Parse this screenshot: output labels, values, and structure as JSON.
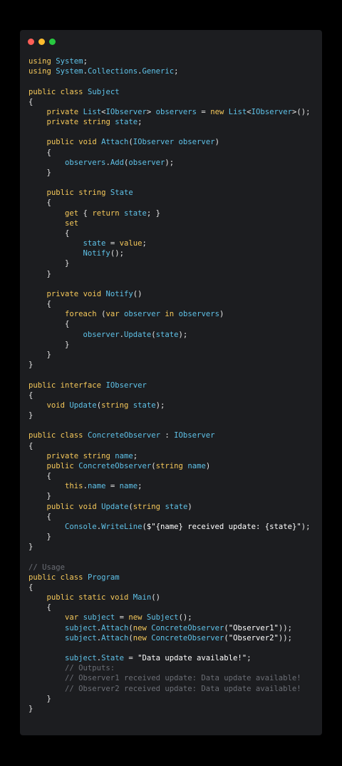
{
  "window": {
    "controls": [
      {
        "name": "close-button",
        "color": "#ff5f57"
      },
      {
        "name": "minimize-button",
        "color": "#febc2e"
      },
      {
        "name": "maximize-button",
        "color": "#28c840"
      }
    ]
  },
  "colors": {
    "background": "#000000",
    "editor": "#1c1d20",
    "keyword": "#f5c85a",
    "type": "#5fc2e8",
    "comment": "#6b6e75",
    "plain": "#e6e6e6"
  },
  "code": {
    "language": "C#",
    "lines": [
      [
        [
          "k",
          "using"
        ],
        [
          "p",
          " "
        ],
        [
          "t",
          "System"
        ],
        [
          "p",
          ";"
        ]
      ],
      [
        [
          "k",
          "using"
        ],
        [
          "p",
          " "
        ],
        [
          "t",
          "System"
        ],
        [
          "p",
          "."
        ],
        [
          "t",
          "Collections"
        ],
        [
          "p",
          "."
        ],
        [
          "t",
          "Generic"
        ],
        [
          "p",
          ";"
        ]
      ],
      [],
      [
        [
          "k",
          "public class"
        ],
        [
          "p",
          " "
        ],
        [
          "t",
          "Subject"
        ]
      ],
      [
        [
          "p",
          "{"
        ]
      ],
      [
        [
          "p",
          "    "
        ],
        [
          "k",
          "private"
        ],
        [
          "p",
          " "
        ],
        [
          "t",
          "List"
        ],
        [
          "p",
          "<"
        ],
        [
          "t",
          "IObserver"
        ],
        [
          "p",
          "> "
        ],
        [
          "t",
          "observers"
        ],
        [
          "p",
          " = "
        ],
        [
          "k",
          "new"
        ],
        [
          "p",
          " "
        ],
        [
          "t",
          "List"
        ],
        [
          "p",
          "<"
        ],
        [
          "t",
          "IObserver"
        ],
        [
          "p",
          ">();"
        ]
      ],
      [
        [
          "p",
          "    "
        ],
        [
          "k",
          "private"
        ],
        [
          "p",
          " "
        ],
        [
          "k",
          "string"
        ],
        [
          "p",
          " "
        ],
        [
          "t",
          "state"
        ],
        [
          "p",
          ";"
        ]
      ],
      [],
      [
        [
          "p",
          "    "
        ],
        [
          "k",
          "public"
        ],
        [
          "p",
          " "
        ],
        [
          "k",
          "void"
        ],
        [
          "p",
          " "
        ],
        [
          "t",
          "Attach"
        ],
        [
          "p",
          "("
        ],
        [
          "t",
          "IObserver observer"
        ],
        [
          "p",
          ")"
        ]
      ],
      [
        [
          "p",
          "    {"
        ]
      ],
      [
        [
          "p",
          "        "
        ],
        [
          "t",
          "observers"
        ],
        [
          "p",
          "."
        ],
        [
          "t",
          "Add"
        ],
        [
          "p",
          "("
        ],
        [
          "t",
          "observer"
        ],
        [
          "p",
          ");"
        ]
      ],
      [
        [
          "p",
          "    }"
        ]
      ],
      [],
      [
        [
          "p",
          "    "
        ],
        [
          "k",
          "public"
        ],
        [
          "p",
          " "
        ],
        [
          "k",
          "string"
        ],
        [
          "p",
          " "
        ],
        [
          "t",
          "State"
        ]
      ],
      [
        [
          "p",
          "    {"
        ]
      ],
      [
        [
          "p",
          "        "
        ],
        [
          "k",
          "get"
        ],
        [
          "p",
          " { "
        ],
        [
          "k",
          "return"
        ],
        [
          "p",
          " "
        ],
        [
          "t",
          "state"
        ],
        [
          "p",
          "; }"
        ]
      ],
      [
        [
          "p",
          "        "
        ],
        [
          "k",
          "set"
        ]
      ],
      [
        [
          "p",
          "        {"
        ]
      ],
      [
        [
          "p",
          "            "
        ],
        [
          "t",
          "state"
        ],
        [
          "p",
          " = "
        ],
        [
          "k",
          "value"
        ],
        [
          "p",
          ";"
        ]
      ],
      [
        [
          "p",
          "            "
        ],
        [
          "t",
          "Notify"
        ],
        [
          "p",
          "();"
        ]
      ],
      [
        [
          "p",
          "        }"
        ]
      ],
      [
        [
          "p",
          "    }"
        ]
      ],
      [],
      [
        [
          "p",
          "    "
        ],
        [
          "k",
          "private"
        ],
        [
          "p",
          " "
        ],
        [
          "k",
          "void"
        ],
        [
          "p",
          " "
        ],
        [
          "t",
          "Notify"
        ],
        [
          "p",
          "()"
        ]
      ],
      [
        [
          "p",
          "    {"
        ]
      ],
      [
        [
          "p",
          "        "
        ],
        [
          "k",
          "foreach"
        ],
        [
          "p",
          " ("
        ],
        [
          "k",
          "var"
        ],
        [
          "p",
          " "
        ],
        [
          "t",
          "observer"
        ],
        [
          "p",
          " "
        ],
        [
          "k",
          "in"
        ],
        [
          "p",
          " "
        ],
        [
          "t",
          "observers"
        ],
        [
          "p",
          ")"
        ]
      ],
      [
        [
          "p",
          "        {"
        ]
      ],
      [
        [
          "p",
          "            "
        ],
        [
          "t",
          "observer"
        ],
        [
          "p",
          "."
        ],
        [
          "t",
          "Update"
        ],
        [
          "p",
          "("
        ],
        [
          "t",
          "state"
        ],
        [
          "p",
          ");"
        ]
      ],
      [
        [
          "p",
          "        }"
        ]
      ],
      [
        [
          "p",
          "    }"
        ]
      ],
      [
        [
          "p",
          "}"
        ]
      ],
      [],
      [
        [
          "k",
          "public interface"
        ],
        [
          "p",
          " "
        ],
        [
          "t",
          "IObserver"
        ]
      ],
      [
        [
          "p",
          "{"
        ]
      ],
      [
        [
          "p",
          "    "
        ],
        [
          "k",
          "void"
        ],
        [
          "p",
          " "
        ],
        [
          "t",
          "Update"
        ],
        [
          "p",
          "("
        ],
        [
          "k",
          "string"
        ],
        [
          "p",
          " "
        ],
        [
          "t",
          "state"
        ],
        [
          "p",
          ");"
        ]
      ],
      [
        [
          "p",
          "}"
        ]
      ],
      [],
      [
        [
          "k",
          "public class"
        ],
        [
          "p",
          " "
        ],
        [
          "t",
          "ConcreteObserver"
        ],
        [
          "p",
          " : "
        ],
        [
          "t",
          "IObserver"
        ]
      ],
      [
        [
          "p",
          "{"
        ]
      ],
      [
        [
          "p",
          "    "
        ],
        [
          "k",
          "private"
        ],
        [
          "p",
          " "
        ],
        [
          "k",
          "string"
        ],
        [
          "p",
          " "
        ],
        [
          "t",
          "name"
        ],
        [
          "p",
          ";"
        ]
      ],
      [
        [
          "p",
          "    "
        ],
        [
          "k",
          "public"
        ],
        [
          "p",
          " "
        ],
        [
          "t",
          "ConcreteObserver"
        ],
        [
          "p",
          "("
        ],
        [
          "k",
          "string"
        ],
        [
          "p",
          " "
        ],
        [
          "t",
          "name"
        ],
        [
          "p",
          ")"
        ]
      ],
      [
        [
          "p",
          "    {"
        ]
      ],
      [
        [
          "p",
          "        "
        ],
        [
          "k",
          "this"
        ],
        [
          "p",
          "."
        ],
        [
          "t",
          "name"
        ],
        [
          "p",
          " = "
        ],
        [
          "t",
          "name"
        ],
        [
          "p",
          ";"
        ]
      ],
      [
        [
          "p",
          "    }"
        ]
      ],
      [
        [
          "p",
          "    "
        ],
        [
          "k",
          "public"
        ],
        [
          "p",
          " "
        ],
        [
          "k",
          "void"
        ],
        [
          "p",
          " "
        ],
        [
          "t",
          "Update"
        ],
        [
          "p",
          "("
        ],
        [
          "k",
          "string"
        ],
        [
          "p",
          " "
        ],
        [
          "t",
          "state"
        ],
        [
          "p",
          ")"
        ]
      ],
      [
        [
          "p",
          "    {"
        ]
      ],
      [
        [
          "p",
          "        "
        ],
        [
          "t",
          "Console"
        ],
        [
          "p",
          "."
        ],
        [
          "t",
          "WriteLine"
        ],
        [
          "p",
          "("
        ],
        [
          "s",
          "$\"{name} received update: {state}\""
        ],
        [
          "p",
          ");"
        ]
      ],
      [
        [
          "p",
          "    }"
        ]
      ],
      [
        [
          "p",
          "}"
        ]
      ],
      [],
      [
        [
          "c",
          "// Usage"
        ]
      ],
      [
        [
          "k",
          "public class"
        ],
        [
          "p",
          " "
        ],
        [
          "t",
          "Program"
        ]
      ],
      [
        [
          "p",
          "{"
        ]
      ],
      [
        [
          "p",
          "    "
        ],
        [
          "k",
          "public static void"
        ],
        [
          "p",
          " "
        ],
        [
          "t",
          "Main"
        ],
        [
          "p",
          "()"
        ]
      ],
      [
        [
          "p",
          "    {"
        ]
      ],
      [
        [
          "p",
          "        "
        ],
        [
          "k",
          "var"
        ],
        [
          "p",
          " "
        ],
        [
          "t",
          "subject"
        ],
        [
          "p",
          " = "
        ],
        [
          "k",
          "new"
        ],
        [
          "p",
          " "
        ],
        [
          "t",
          "Subject"
        ],
        [
          "p",
          "();"
        ]
      ],
      [
        [
          "p",
          "        "
        ],
        [
          "t",
          "subject"
        ],
        [
          "p",
          "."
        ],
        [
          "t",
          "Attach"
        ],
        [
          "p",
          "("
        ],
        [
          "k",
          "new"
        ],
        [
          "p",
          " "
        ],
        [
          "t",
          "ConcreteObserver"
        ],
        [
          "p",
          "("
        ],
        [
          "s",
          "\"Observer1\""
        ],
        [
          "p",
          "));"
        ]
      ],
      [
        [
          "p",
          "        "
        ],
        [
          "t",
          "subject"
        ],
        [
          "p",
          "."
        ],
        [
          "t",
          "Attach"
        ],
        [
          "p",
          "("
        ],
        [
          "k",
          "new"
        ],
        [
          "p",
          " "
        ],
        [
          "t",
          "ConcreteObserver"
        ],
        [
          "p",
          "("
        ],
        [
          "s",
          "\"Observer2\""
        ],
        [
          "p",
          "));"
        ]
      ],
      [],
      [
        [
          "p",
          "        "
        ],
        [
          "t",
          "subject"
        ],
        [
          "p",
          "."
        ],
        [
          "t",
          "State"
        ],
        [
          "p",
          " = "
        ],
        [
          "s",
          "\"Data update available!\""
        ],
        [
          "p",
          ";"
        ]
      ],
      [
        [
          "p",
          "        "
        ],
        [
          "c",
          "// Outputs:"
        ]
      ],
      [
        [
          "p",
          "        "
        ],
        [
          "c",
          "// Observer1 received update: Data update available!"
        ]
      ],
      [
        [
          "p",
          "        "
        ],
        [
          "c",
          "// Observer2 received update: Data update available!"
        ]
      ],
      [
        [
          "p",
          "    }"
        ]
      ],
      [
        [
          "p",
          "}"
        ]
      ]
    ]
  }
}
